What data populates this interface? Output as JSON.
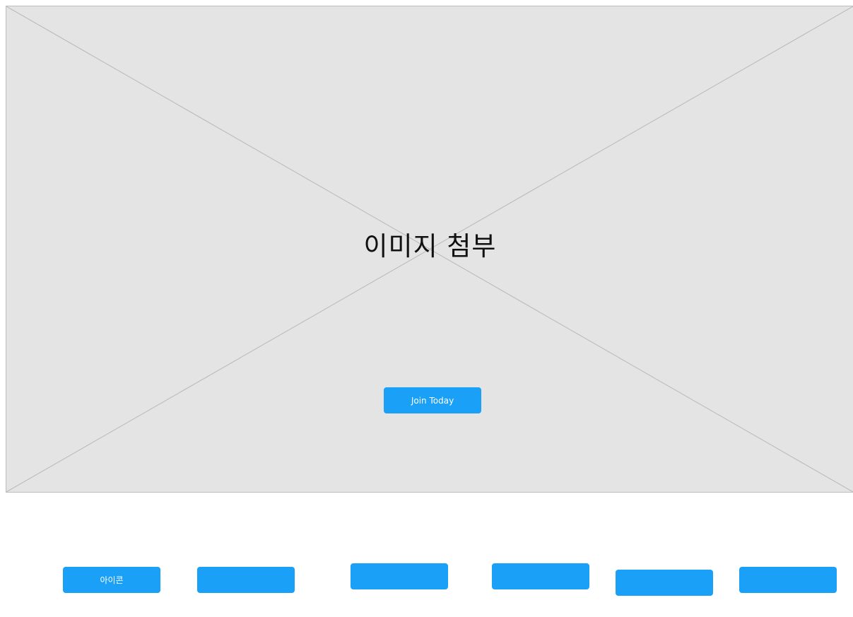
{
  "hero": {
    "placeholder_text": "이미지 첨부",
    "cta_label": "Join Today"
  },
  "icon_buttons": [
    {
      "label": "아이콘"
    },
    {
      "label": ""
    },
    {
      "label": ""
    },
    {
      "label": ""
    },
    {
      "label": ""
    },
    {
      "label": ""
    }
  ],
  "colors": {
    "button": "#1aa0f7",
    "placeholder_bg": "#e4e4e4",
    "placeholder_border": "#bdbdbd"
  }
}
